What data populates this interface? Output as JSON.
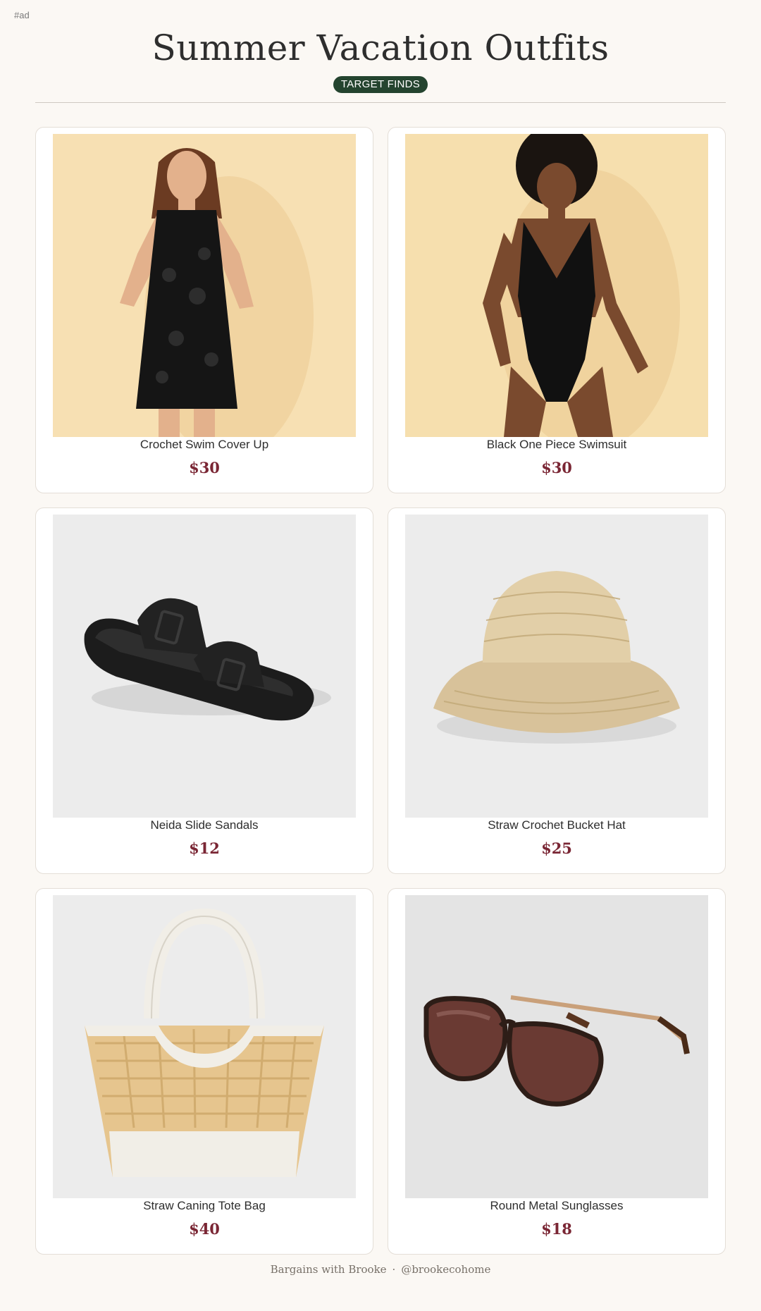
{
  "ad_tag": "#ad",
  "title": "Summer Vacation Outfits",
  "badge": "TARGET FINDS",
  "products": [
    {
      "name": "Crochet Swim Cover Up",
      "price": "$30",
      "icon": "crochet-cover-up-photo"
    },
    {
      "name": "Black One Piece Swimsuit",
      "price": "$30",
      "icon": "one-piece-swimsuit-photo"
    },
    {
      "name": "Neida Slide Sandals",
      "price": "$12",
      "icon": "slide-sandals-photo"
    },
    {
      "name": "Straw Crochet Bucket Hat",
      "price": "$25",
      "icon": "bucket-hat-photo"
    },
    {
      "name": "Straw Caning Tote Bag",
      "price": "$40",
      "icon": "tote-bag-photo"
    },
    {
      "name": "Round Metal Sunglasses",
      "price": "$18",
      "icon": "sunglasses-photo"
    }
  ],
  "footer": {
    "author": "Bargains with Brooke",
    "separator": "·",
    "handle": "@brookecohome"
  },
  "colors": {
    "badge_bg": "#24442f",
    "price": "#7a2634",
    "page_bg": "#fbf8f4"
  }
}
